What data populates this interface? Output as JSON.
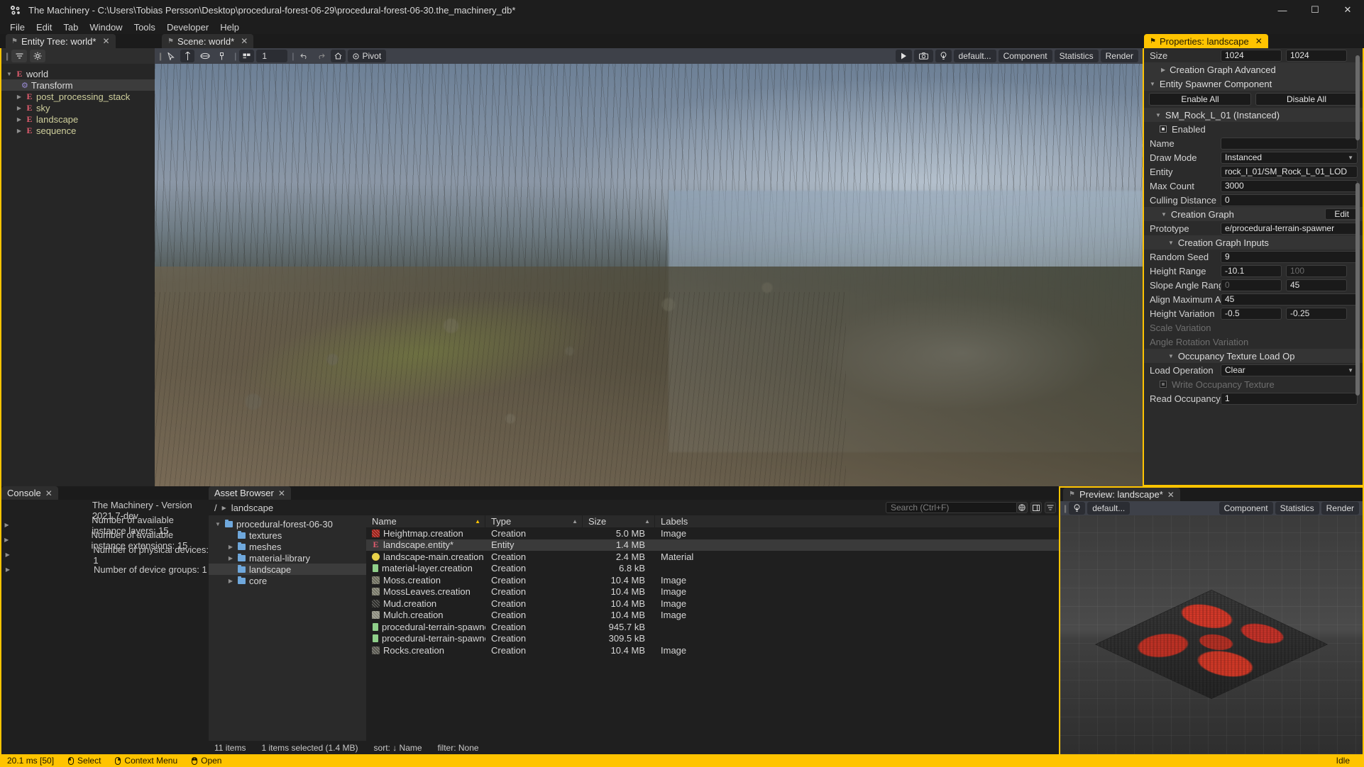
{
  "window": {
    "title": "The Machinery - C:\\Users\\Tobias Persson\\Desktop\\procedural-forest-06-29\\procedural-forest-06-30.the_machinery_db*",
    "minimize": "—",
    "maximize": "☐",
    "close": "✕"
  },
  "menubar": {
    "items": [
      "File",
      "Edit",
      "Tab",
      "Window",
      "Tools",
      "Developer",
      "Help"
    ]
  },
  "tabs": {
    "entity_tree": {
      "label": "Entity Tree: world*",
      "pin": "⚑",
      "close": "✕"
    },
    "scene": {
      "label": "Scene: world*",
      "pin": "⚑",
      "close": "✕"
    },
    "properties": {
      "label": "Properties: landscape",
      "pin": "⚑",
      "close": "✕"
    }
  },
  "entity_tree": {
    "toolbar": {
      "filter_icon": "filter-icon",
      "settings_icon": "gear-icon"
    },
    "nodes": [
      {
        "label": "world",
        "indent": 0,
        "expanded": true,
        "icon": "entity-icon",
        "arrow": "▼",
        "selected": false
      },
      {
        "label": "Transform",
        "indent": 1,
        "expanded": null,
        "icon": "component-gear-icon",
        "arrow": "",
        "selected": true
      },
      {
        "label": "post_processing_stack",
        "indent": 1,
        "expanded": false,
        "icon": "entity-icon",
        "arrow": "▶",
        "selected": false
      },
      {
        "label": "sky",
        "indent": 1,
        "expanded": false,
        "icon": "entity-icon",
        "arrow": "▶",
        "selected": false
      },
      {
        "label": "landscape",
        "indent": 1,
        "expanded": false,
        "icon": "entity-icon",
        "arrow": "▶",
        "selected": false
      },
      {
        "label": "sequence",
        "indent": 1,
        "expanded": false,
        "icon": "entity-icon",
        "arrow": "▶",
        "selected": false
      }
    ]
  },
  "scene_toolbar": {
    "select_icon": "cursor-select-icon",
    "move_icon": "move-gizmo-icon",
    "rotate_icon": "rotate-gizmo-icon",
    "scale_icon": "scale-gizmo-icon",
    "grid_icon": "grid-snap-icon",
    "grid_value": "1",
    "undo_icon": "undo-arrow-icon",
    "redo_icon": "redo-arrow-icon",
    "home_icon": "home-icon",
    "pivot_icon": "pivot-icon",
    "pivot_label": "Pivot",
    "play_icon": "play-icon",
    "camera_icon": "camera-icon",
    "light_icon": "light-bulb-icon",
    "preset_label": "default...",
    "component_label": "Component",
    "statistics_label": "Statistics",
    "render_label": "Render"
  },
  "properties": {
    "rows": [
      {
        "kind": "field2",
        "label": "Size",
        "v1": "1024",
        "v2": "1024",
        "dim1": false,
        "dim2": false
      },
      {
        "kind": "section",
        "label": "Creation Graph Advanced",
        "tri": "▶",
        "indent": 24,
        "edit": null
      },
      {
        "kind": "section",
        "label": "Entity Spawner Component",
        "tri": "▼",
        "indent": 8,
        "edit": null
      },
      {
        "kind": "buttons",
        "b1": "Enable All",
        "b2": "Disable All"
      },
      {
        "kind": "section",
        "label": "SM_Rock_L_01 (Instanced)",
        "tri": "▼",
        "indent": 16,
        "edit": null
      },
      {
        "kind": "check",
        "label": "Enabled",
        "dim": false
      },
      {
        "kind": "field",
        "label": "Name",
        "value": "",
        "dim": false
      },
      {
        "kind": "select",
        "label": "Draw Mode",
        "value": "Instanced"
      },
      {
        "kind": "field",
        "label": "Entity",
        "value": "rock_l_01/SM_Rock_L_01_LOD",
        "dim": false
      },
      {
        "kind": "field",
        "label": "Max Count",
        "value": "3000",
        "dim": false
      },
      {
        "kind": "field",
        "label": "Culling Distance",
        "value": "0",
        "dim": false
      },
      {
        "kind": "section",
        "label": "Creation Graph",
        "tri": "▼",
        "indent": 24,
        "edit": "Edit"
      },
      {
        "kind": "field",
        "label": "Prototype",
        "value": "e/procedural-terrain-spawner",
        "dim": false
      },
      {
        "kind": "section",
        "label": "Creation Graph Inputs",
        "tri": "▼",
        "indent": 34,
        "edit": null
      },
      {
        "kind": "field",
        "label": "Random Seed",
        "value": "9",
        "dim": false
      },
      {
        "kind": "field2",
        "label": "Height Range",
        "v1": "-10.1",
        "v2": "100",
        "dim1": false,
        "dim2": true
      },
      {
        "kind": "field2",
        "label": "Slope Angle Range",
        "v1": "0",
        "v2": "45",
        "dim1": true,
        "dim2": false
      },
      {
        "kind": "field",
        "label": "Align Maximum Angle",
        "value": "45",
        "dim": false
      },
      {
        "kind": "field2",
        "label": "Height Variation",
        "v1": "-0.5",
        "v2": "-0.25",
        "dim1": false,
        "dim2": false
      },
      {
        "kind": "label",
        "label": "Scale Variation",
        "dim": true
      },
      {
        "kind": "label",
        "label": "Angle Rotation Variation",
        "dim": true
      },
      {
        "kind": "section",
        "label": "Occupancy Texture Load Op",
        "tri": "▼",
        "indent": 34,
        "edit": null
      },
      {
        "kind": "select",
        "label": "Load Operation",
        "value": "Clear"
      },
      {
        "kind": "check",
        "label": "Write Occupancy Texture",
        "dim": true
      },
      {
        "kind": "field",
        "label": "Read Occupancy Text",
        "value": "1",
        "dim": false
      }
    ]
  },
  "console": {
    "tab_label": "Console",
    "close": "✕",
    "lines": [
      {
        "text": "The Machinery - Version 2021.7-dev",
        "arrow": false
      },
      {
        "text": "Number of available instance layers: 15",
        "arrow": true
      },
      {
        "text": "Number of available instance extensions: 15",
        "arrow": true
      },
      {
        "text": "Number of physical devices: 1",
        "arrow": true
      },
      {
        "text": "Number of device groups: 1",
        "arrow": true
      }
    ]
  },
  "asset_browser": {
    "tab_label": "Asset Browser",
    "close": "✕",
    "breadcrumb": {
      "root": "/",
      "sep": "▶",
      "current": "landscape"
    },
    "search": {
      "placeholder": "Search (Ctrl+F)",
      "value": ""
    },
    "icons": {
      "globe": "globe-icon",
      "panel": "panel-layout-icon",
      "filter": "filter-icon"
    },
    "tree": [
      {
        "label": "procedural-forest-06-30",
        "indent": 0,
        "arrow": "▼",
        "selected": false
      },
      {
        "label": "textures",
        "indent": 1,
        "arrow": "",
        "selected": false
      },
      {
        "label": "meshes",
        "indent": 1,
        "arrow": "▶",
        "selected": false
      },
      {
        "label": "material-library",
        "indent": 1,
        "arrow": "▶",
        "selected": false
      },
      {
        "label": "landscape",
        "indent": 1,
        "arrow": "",
        "selected": true
      },
      {
        "label": "core",
        "indent": 1,
        "arrow": "▶",
        "selected": false
      }
    ],
    "columns": [
      {
        "label": "Name",
        "sort": "▲"
      },
      {
        "label": "Type",
        "sort": "▲"
      },
      {
        "label": "Size",
        "sort": "▲"
      },
      {
        "label": "Labels",
        "sort": ""
      }
    ],
    "files": [
      {
        "name": "Heightmap.creation",
        "type": "Creation",
        "size": "5.0 MB",
        "labels": "Image",
        "thumb": "#9e1c14",
        "icon": "texture-thumb",
        "selected": false
      },
      {
        "name": "landscape.entity*",
        "type": "Entity",
        "size": "1.4 MB",
        "labels": "",
        "thumb": "",
        "icon": "entity-icon",
        "selected": true
      },
      {
        "name": "landscape-main.creation",
        "type": "Creation",
        "size": "2.4 MB",
        "labels": "Material",
        "thumb": "#e8d24a",
        "icon": "sphere-thumb",
        "selected": false
      },
      {
        "name": "material-layer.creation",
        "type": "Creation",
        "size": "6.8 kB",
        "labels": "",
        "thumb": "#8fcf8a",
        "icon": "doc-thumb",
        "selected": false
      },
      {
        "name": "Moss.creation",
        "type": "Creation",
        "size": "10.4 MB",
        "labels": "Image",
        "thumb": "#6a6a5a",
        "icon": "texture-thumb",
        "selected": false
      },
      {
        "name": "MossLeaves.creation",
        "type": "Creation",
        "size": "10.4 MB",
        "labels": "Image",
        "thumb": "#757565",
        "icon": "texture-thumb",
        "selected": false
      },
      {
        "name": "Mud.creation",
        "type": "Creation",
        "size": "10.4 MB",
        "labels": "Image",
        "thumb": "#2b2b28",
        "icon": "texture-thumb",
        "selected": false
      },
      {
        "name": "Mulch.creation",
        "type": "Creation",
        "size": "10.4 MB",
        "labels": "Image",
        "thumb": "#8a8a7c",
        "icon": "texture-thumb",
        "selected": false
      },
      {
        "name": "procedural-terrain-spawner.creatio",
        "type": "Creation",
        "size": "945.7 kB",
        "labels": "",
        "thumb": "#8fcf8a",
        "icon": "doc-thumb",
        "selected": false
      },
      {
        "name": "procedural-terrain-spawner-cell.cr",
        "type": "Creation",
        "size": "309.5 kB",
        "labels": "",
        "thumb": "#8fcf8a",
        "icon": "doc-thumb",
        "selected": false
      },
      {
        "name": "Rocks.creation",
        "type": "Creation",
        "size": "10.4 MB",
        "labels": "Image",
        "thumb": "#55544c",
        "icon": "texture-thumb",
        "selected": false
      }
    ],
    "footer": {
      "items_count": "11 items",
      "selection": "1 items selected (1.4 MB)",
      "sort": "sort: ↓ Name",
      "filter": "filter: None"
    }
  },
  "preview": {
    "tab_label": "Preview: landscape*",
    "pin": "⚑",
    "close": "✕",
    "toolbar": {
      "light_icon": "light-bulb-icon",
      "preset_label": "default...",
      "component_label": "Component",
      "statistics_label": "Statistics",
      "render_label": "Render"
    }
  },
  "statusbar": {
    "timing": "20.1 ms [50]",
    "select_icon": "mouse-left-icon",
    "select": "Select",
    "context_icon": "mouse-right-icon",
    "context": "Context Menu",
    "open_icon": "mouse-double-icon",
    "open": "Open",
    "idle": "Idle"
  },
  "colors": {
    "accent": "#ffc400",
    "panel": "#2b2b2b",
    "entity_red": "#e05c6e",
    "folder_blue": "#6fa8dc"
  }
}
